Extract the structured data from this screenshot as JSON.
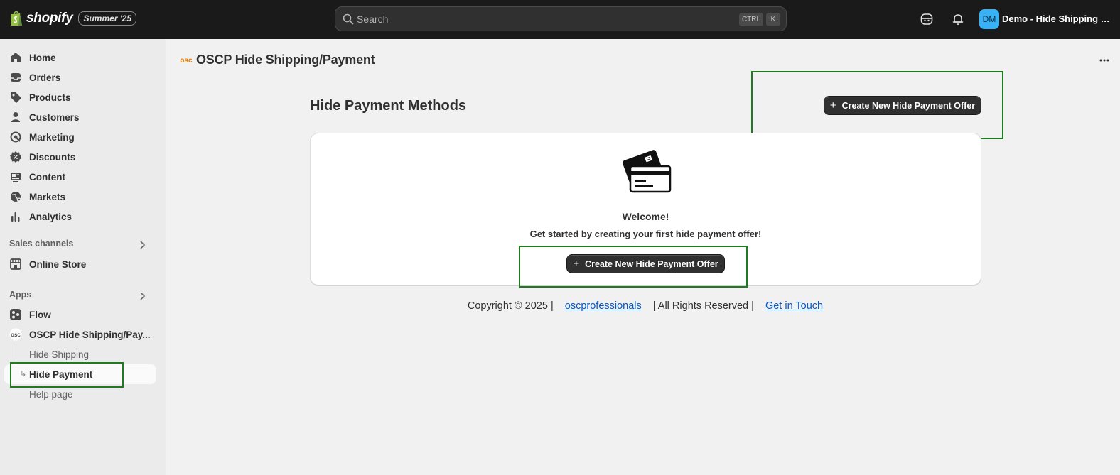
{
  "topbar": {
    "brand": "shopify",
    "edition": "Summer '25",
    "search_placeholder": "Search",
    "shortcut_ctrl": "CTRL",
    "shortcut_k": "K",
    "avatar_initials": "DM",
    "store_name": "Demo - Hide Shipping Me..."
  },
  "sidebar": {
    "items": [
      {
        "label": "Home",
        "icon": "home-icon"
      },
      {
        "label": "Orders",
        "icon": "inbox-icon"
      },
      {
        "label": "Products",
        "icon": "tag-icon"
      },
      {
        "label": "Customers",
        "icon": "person-icon"
      },
      {
        "label": "Marketing",
        "icon": "target-icon"
      },
      {
        "label": "Discounts",
        "icon": "discount-icon"
      },
      {
        "label": "Content",
        "icon": "content-icon"
      },
      {
        "label": "Markets",
        "icon": "globe-icon"
      },
      {
        "label": "Analytics",
        "icon": "bar-chart-icon"
      }
    ],
    "sales_channels_label": "Sales channels",
    "online_store": "Online Store",
    "apps_label": "Apps",
    "flow": "Flow",
    "app_name": "OSCP Hide Shipping/Pay...",
    "sub_items": {
      "hide_shipping": "Hide Shipping",
      "hide_payment": "Hide Payment",
      "help_page": "Help page"
    }
  },
  "main": {
    "app_title": "OSCP Hide Shipping/Payment",
    "page_title": "Hide Payment Methods",
    "create_button": "Create New Hide Payment Offer",
    "card": {
      "welcome": "Welcome!",
      "subtitle": "Get started by creating your first hide payment offer!",
      "create_button": "Create New Hide Payment Offer"
    },
    "footer": {
      "copyright": "Copyright © 2025 |",
      "company_link": "oscprofessionals",
      "rights": "| All Rights Reserved |",
      "contact_link": "Get in Touch"
    }
  },
  "colors": {
    "topbar_bg": "#1a1a1a",
    "primary_button": "#303030",
    "link": "#005bd3",
    "highlight_box": "#1e7b1e",
    "avatar": "#38b2f6"
  }
}
